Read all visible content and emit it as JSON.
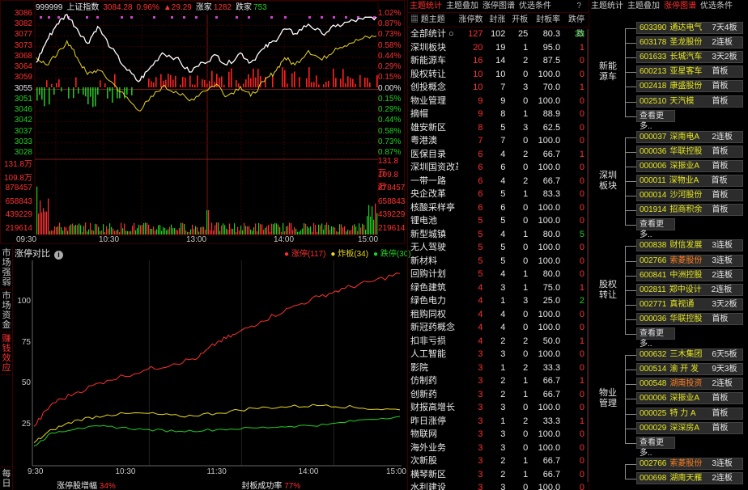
{
  "intraday": {
    "code": "999999",
    "name": "上证指数",
    "price": "3084.28",
    "pct": "0.96%",
    "change": "▲29.29",
    "up_label": "涨家",
    "up_count": "1282",
    "down_label": "跌家",
    "down_count": "753",
    "price_ticks": [
      "3086",
      "3082",
      "3077",
      "3073",
      "3068",
      "3064",
      "3059",
      "3055",
      "3051",
      "3046",
      "3042",
      "3037",
      "3033",
      "3028"
    ],
    "pct_ticks": [
      "1.02%",
      "0.87%",
      "0.73%",
      "0.58%",
      "0.44%",
      "0.29%",
      "0.15%",
      "0.00%",
      "0.15%",
      "0.29%",
      "0.44%",
      "0.58%",
      "0.73%",
      "0.87%"
    ],
    "vol_ticks": [
      "131.8万",
      "109.8万",
      "878457",
      "658843",
      "439229",
      "219614"
    ],
    "time_ticks": [
      "09:30",
      "10:30",
      "13:00",
      "14:00",
      "15:00"
    ],
    "colors": {
      "white_line": "#ffffff",
      "yellow_line": "#e8d820",
      "up": "#ff3030",
      "down": "#20d020"
    }
  },
  "side_tabs": [
    "市场强弱",
    "市场资金",
    "赚钱效应",
    "每日"
  ],
  "zt_compare": {
    "title": "涨停对比",
    "info_icon": "info-icon",
    "legend": [
      {
        "label": "涨停",
        "count": "(117)",
        "color": "#ff3030"
      },
      {
        "label": "炸板",
        "count": "(34)",
        "color": "#e8d820"
      },
      {
        "label": "跌停",
        "count": "(30)",
        "color": "#20d020"
      }
    ],
    "y_ticks": [
      "100",
      "75",
      "50",
      "25"
    ],
    "x_ticks": [
      "9:30",
      "10:30",
      "11:30",
      "14:00",
      "15:00"
    ],
    "stat1_label": "涨停股增幅",
    "stat1_value": "34%",
    "stat2_label": "封板成功率",
    "stat2_value": "77%"
  },
  "theme_table": {
    "tabs": [
      "主题统计",
      "主题叠加",
      "涨停图谱",
      "优选条件"
    ],
    "active_tab": 0,
    "help": "?",
    "headers": [
      "题主题",
      "涨停数",
      "封涨",
      "开板",
      "封板率",
      "跌停数"
    ],
    "rows": [
      [
        "全部统计 ○",
        "127",
        "102",
        "25",
        "80.3",
        "23"
      ],
      [
        "深圳板块",
        "20",
        "19",
        "1",
        "95.0",
        "1"
      ],
      [
        "新能源车",
        "16",
        "14",
        "2",
        "87.5",
        "0"
      ],
      [
        "股权转让",
        "10",
        "10",
        "0",
        "100.0",
        "0"
      ],
      [
        "创投概念",
        "10",
        "7",
        "3",
        "70.0",
        "1"
      ],
      [
        "物业管理",
        "9",
        "9",
        "0",
        "100.0",
        "0"
      ],
      [
        "摘帽",
        "9",
        "8",
        "1",
        "88.9",
        "0"
      ],
      [
        "雄安新区",
        "8",
        "5",
        "3",
        "62.5",
        "0"
      ],
      [
        "粤港澳",
        "7",
        "7",
        "0",
        "100.0",
        "0"
      ],
      [
        "医保目录",
        "6",
        "4",
        "2",
        "66.7",
        "1"
      ],
      [
        "深圳国资改革",
        "6",
        "6",
        "0",
        "100.0",
        "0"
      ],
      [
        "一带一路",
        "6",
        "4",
        "2",
        "66.7",
        "0"
      ],
      [
        "央企改革",
        "6",
        "5",
        "1",
        "83.3",
        "0"
      ],
      [
        "核酸采样亭",
        "6",
        "6",
        "0",
        "100.0",
        "0"
      ],
      [
        "锂电池",
        "5",
        "5",
        "0",
        "100.0",
        "0"
      ],
      [
        "新型城镇",
        "5",
        "4",
        "1",
        "80.0",
        "5"
      ],
      [
        "无人驾驶",
        "5",
        "5",
        "0",
        "100.0",
        "0"
      ],
      [
        "新材料",
        "5",
        "5",
        "0",
        "100.0",
        "0"
      ],
      [
        "回购计划",
        "5",
        "4",
        "1",
        "80.0",
        "0"
      ],
      [
        "绿色建筑",
        "4",
        "3",
        "1",
        "75.0",
        "1"
      ],
      [
        "绿色电力",
        "4",
        "1",
        "3",
        "25.0",
        "2"
      ],
      [
        "租购同权",
        "4",
        "4",
        "0",
        "100.0",
        "0"
      ],
      [
        "新冠药概念",
        "4",
        "4",
        "0",
        "100.0",
        "0"
      ],
      [
        "扣非亏损",
        "4",
        "2",
        "2",
        "50.0",
        "1"
      ],
      [
        "人工智能",
        "3",
        "3",
        "0",
        "100.0",
        "0"
      ],
      [
        "影院",
        "3",
        "1",
        "2",
        "33.3",
        "0"
      ],
      [
        "仿制药",
        "3",
        "2",
        "1",
        "66.7",
        "1"
      ],
      [
        "创新药",
        "3",
        "2",
        "1",
        "66.7",
        "0"
      ],
      [
        "财报高增长",
        "3",
        "3",
        "0",
        "100.0",
        "0"
      ],
      [
        "昨日涨停",
        "3",
        "1",
        "2",
        "33.3",
        "1"
      ],
      [
        "物联网",
        "3",
        "3",
        "0",
        "100.0",
        "0"
      ],
      [
        "海外业务",
        "3",
        "3",
        "0",
        "100.0",
        "0"
      ],
      [
        "次新股",
        "3",
        "2",
        "1",
        "66.7",
        "0"
      ],
      [
        "横琴新区",
        "3",
        "2",
        "1",
        "66.7",
        "0"
      ],
      [
        "水利建设",
        "3",
        "3",
        "0",
        "100.0",
        "0"
      ]
    ],
    "down_green_rows": [
      15,
      20
    ]
  },
  "tree": {
    "tabs": [
      "主题统计",
      "主题叠加",
      "涨停图谱",
      "优选条件"
    ],
    "active_tab": 2,
    "more_label": "查看更多..",
    "groups": [
      {
        "label": "新能源车",
        "stocks": [
          {
            "code": "603390",
            "name": "通达电气",
            "tag": "7天4板"
          },
          {
            "code": "603178",
            "name": "圣龙股份",
            "tag": "2连板"
          },
          {
            "code": "601633",
            "name": "长城汽车",
            "tag": "3天2板"
          },
          {
            "code": "600213",
            "name": "亚星客车",
            "tag": "首板"
          },
          {
            "code": "002418",
            "name": "康盛股份",
            "tag": "首板"
          },
          {
            "code": "002510",
            "name": "天汽模",
            "tag": "首板"
          }
        ]
      },
      {
        "label": "深圳板块",
        "stocks": [
          {
            "code": "000037",
            "name": "深南电A",
            "tag": "2连板"
          },
          {
            "code": "000036",
            "name": "华联控股",
            "tag": "首板"
          },
          {
            "code": "000006",
            "name": "深振业A",
            "tag": "首板"
          },
          {
            "code": "000011",
            "name": "深物业A",
            "tag": "首板"
          },
          {
            "code": "000014",
            "name": "沙河股份",
            "tag": "首板"
          },
          {
            "code": "001914",
            "name": "招商积余",
            "tag": "首板"
          }
        ]
      },
      {
        "label": "股权转让",
        "stocks": [
          {
            "code": "000838",
            "name": "财信发展",
            "tag": "3连板"
          },
          {
            "code": "002766",
            "name": "索菱股份",
            "tag": "3连板",
            "hl": true
          },
          {
            "code": "600841",
            "name": "中洲控股",
            "tag": "2连板"
          },
          {
            "code": "002811",
            "name": "郑中设计",
            "tag": "2连板"
          },
          {
            "code": "002771",
            "name": "真视通",
            "tag": "3天2板"
          },
          {
            "code": "000036",
            "name": "华联控股",
            "tag": "首板"
          }
        ]
      },
      {
        "label": "物业管理",
        "stocks": [
          {
            "code": "000632",
            "name": "三木集团",
            "tag": "6天5板"
          },
          {
            "code": "000514",
            "name": "渝 开 发",
            "tag": "9天3板"
          },
          {
            "code": "000548",
            "name": "湖南投资",
            "tag": "2连板",
            "hl": true
          },
          {
            "code": "000006",
            "name": "深振业A",
            "tag": "首板"
          },
          {
            "code": "000025",
            "name": "特 力 A",
            "tag": "首板"
          },
          {
            "code": "000029",
            "name": "深深房A",
            "tag": "首板"
          }
        ]
      },
      {
        "label": "",
        "stocks": [
          {
            "code": "002766",
            "name": "索菱股份",
            "tag": "3连板",
            "hl": true
          },
          {
            "code": "000698",
            "name": "湖南天雁",
            "tag": "2连板"
          }
        ]
      }
    ]
  }
}
